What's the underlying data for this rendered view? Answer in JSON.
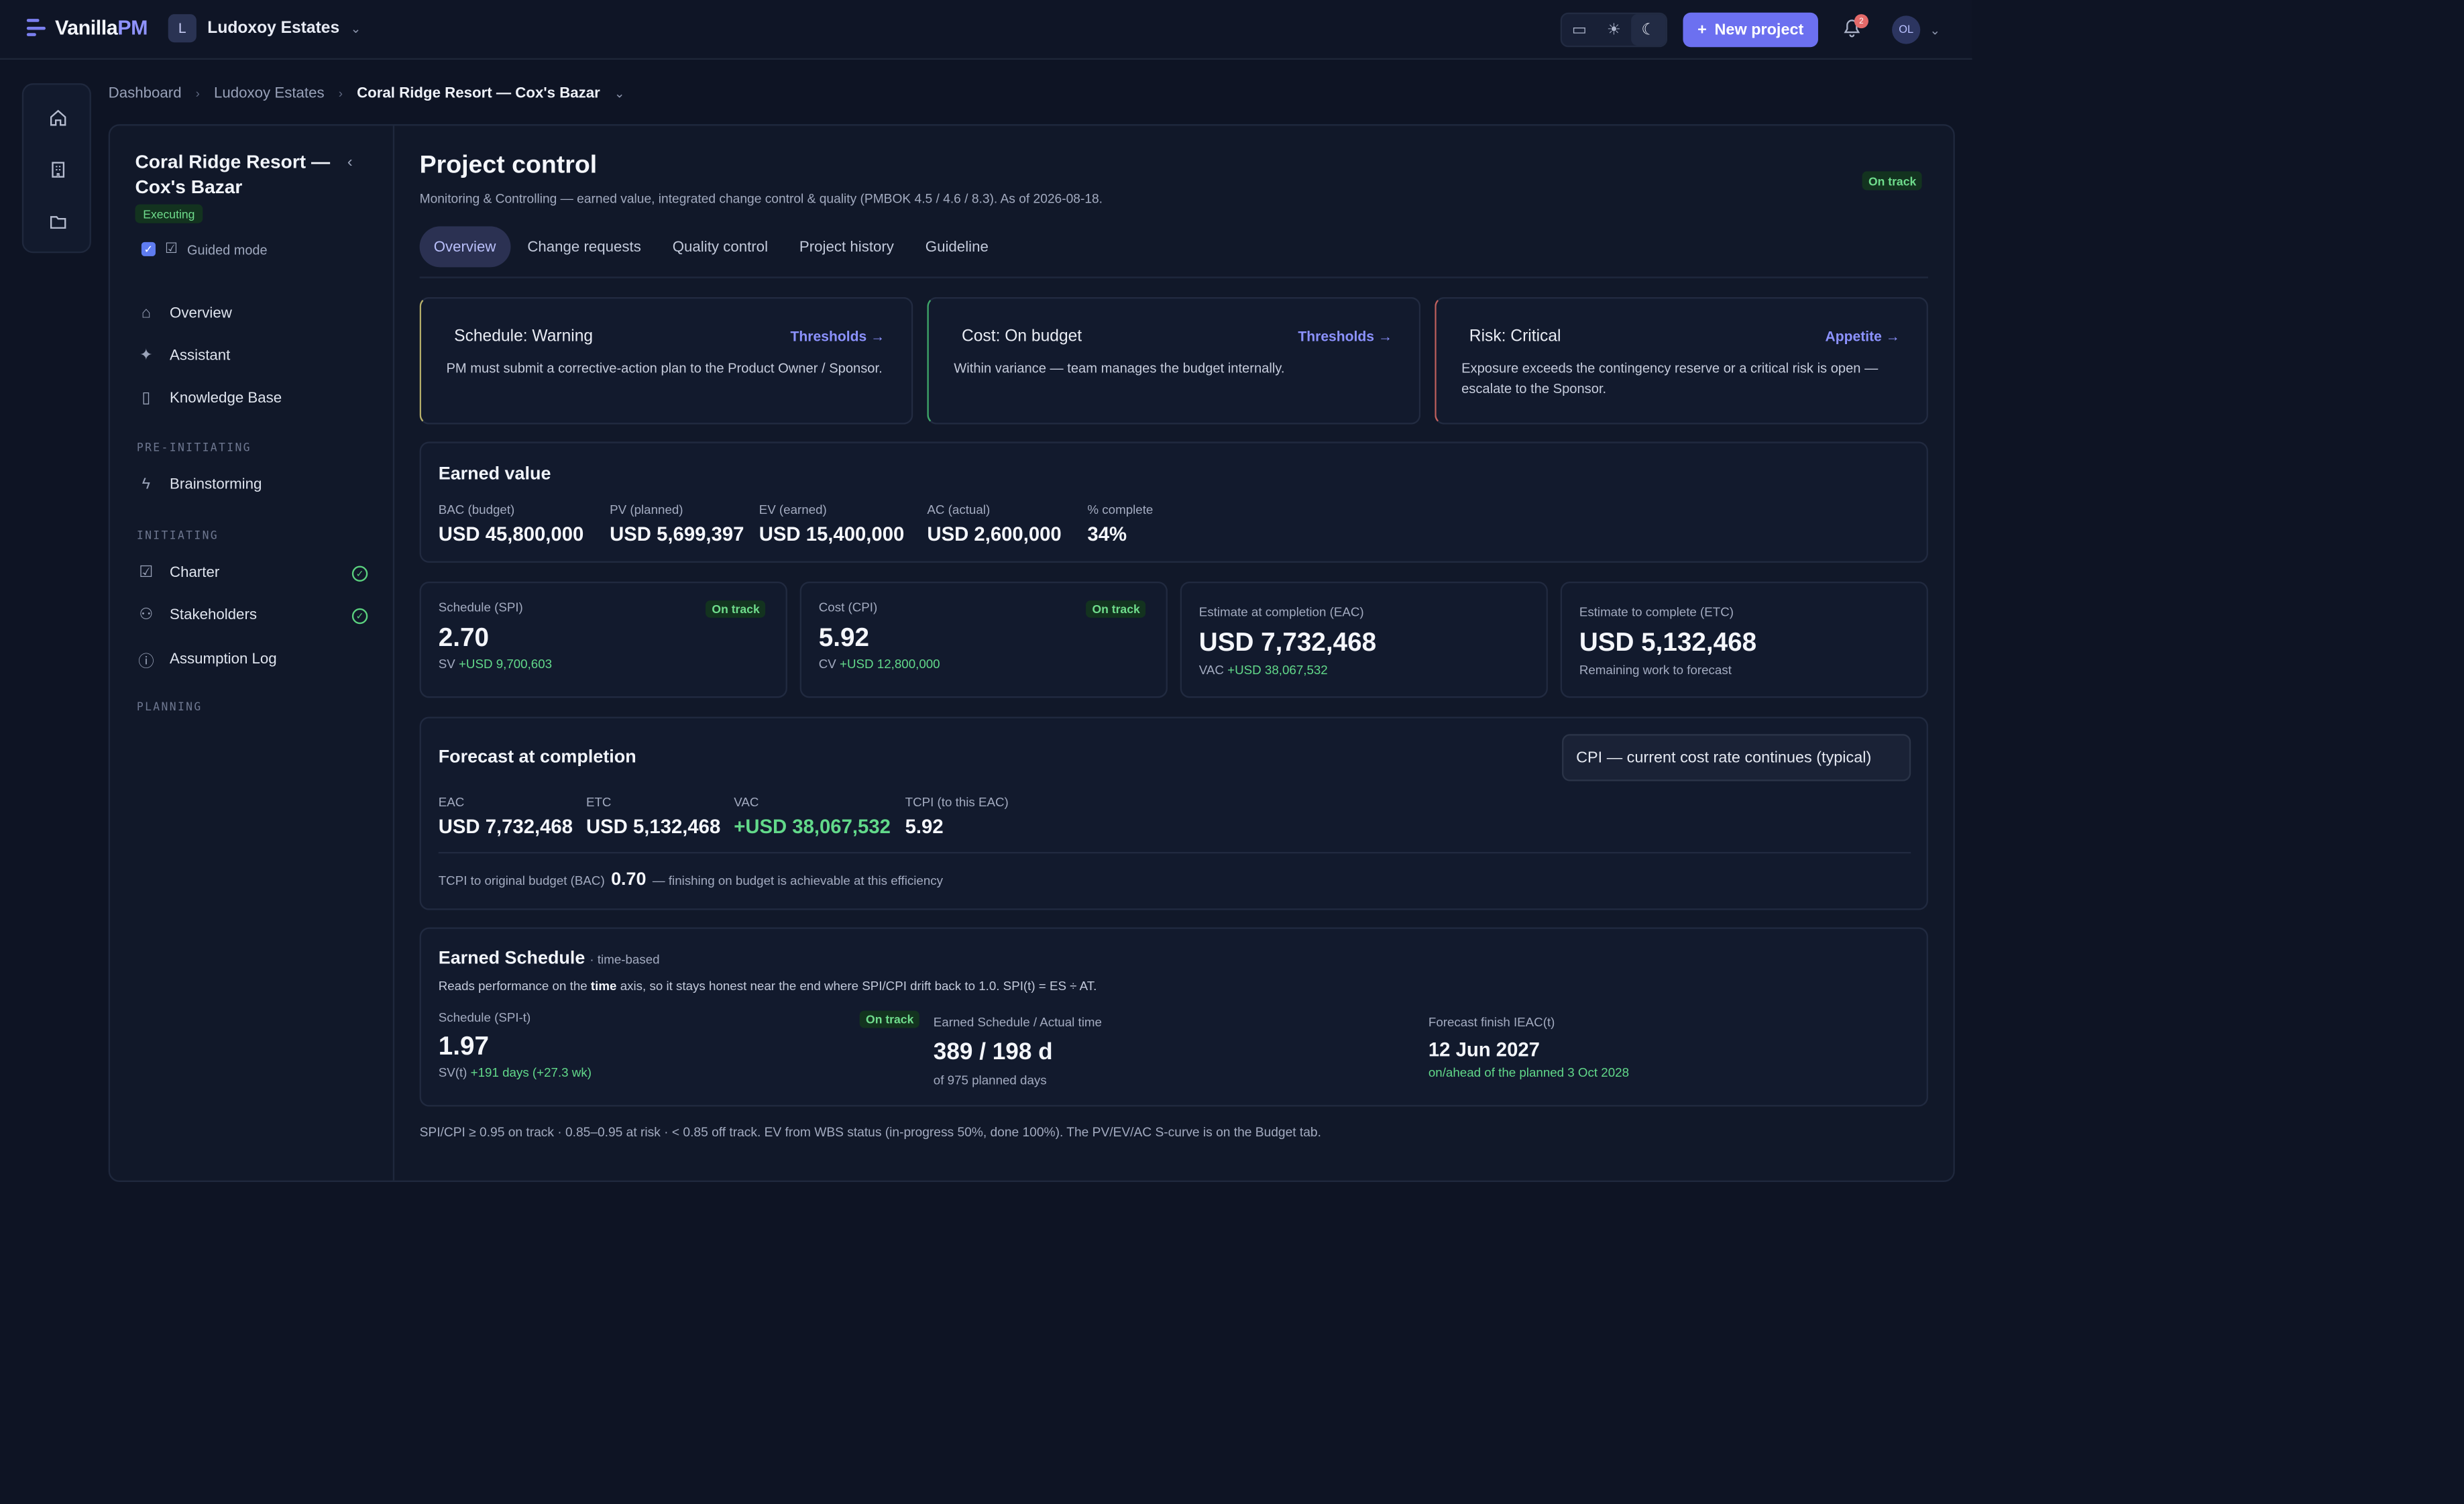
{
  "app": {
    "name_main": "Vanilla",
    "name_accent": "PM"
  },
  "org": {
    "initial": "L",
    "name": "Ludoxoy Estates"
  },
  "header": {
    "new_project_label": "New project",
    "notifications_count": "2",
    "user_initials": "OL"
  },
  "breadcrumb": {
    "items": [
      "Dashboard",
      "Ludoxoy Estates"
    ],
    "current": "Coral Ridge Resort — Cox's Bazar"
  },
  "sidebar": {
    "project_title": "Coral Ridge Resort — Cox's Bazar",
    "phase": "Executing",
    "guided_mode": "Guided mode",
    "items": [
      "Overview",
      "Assistant",
      "Knowledge Base",
      "Brainstorming",
      "Charter",
      "Stakeholders",
      "Assumption Log"
    ],
    "sections": [
      "PRE-INITIATING",
      "INITIATING",
      "PLANNING"
    ]
  },
  "page": {
    "title": "Project control",
    "subtitle": "Monitoring & Controlling — earned value, integrated change control & quality (PMBOK 4.5 / 4.6 / 8.3). As of 2026-08-18.",
    "status": "On track",
    "tabs": [
      "Overview",
      "Change requests",
      "Quality control",
      "Project history",
      "Guideline"
    ]
  },
  "alerts": [
    {
      "title": "Schedule: Warning",
      "link": "Thresholds →",
      "body": "PM must submit a corrective-action plan to the Product Owner / Sponsor."
    },
    {
      "title": "Cost: On budget",
      "link": "Thresholds →",
      "body": "Within variance — team manages the budget internally."
    },
    {
      "title": "Risk: Critical",
      "link": "Appetite →",
      "body": "Exposure exceeds the contingency reserve or a critical risk is open — escalate to the Sponsor."
    }
  ],
  "earned_value": {
    "title": "Earned value",
    "metrics": [
      {
        "label": "BAC (budget)",
        "value": "USD 45,800,000"
      },
      {
        "label": "PV (planned)",
        "value": "USD 5,699,397"
      },
      {
        "label": "EV (earned)",
        "value": "USD 15,400,000"
      },
      {
        "label": "AC (actual)",
        "value": "USD 2,600,000"
      },
      {
        "label": "% complete",
        "value": "34%"
      }
    ]
  },
  "kpis": {
    "spi": {
      "label": "Schedule (SPI)",
      "status": "On track",
      "value": "2.70",
      "sub_label": "SV",
      "sub_value": "+USD 9,700,603"
    },
    "cpi": {
      "label": "Cost (CPI)",
      "status": "On track",
      "value": "5.92",
      "sub_label": "CV",
      "sub_value": "+USD 12,800,000"
    },
    "eac": {
      "label": "Estimate at completion (EAC)",
      "value": "USD 7,732,468",
      "sub_label": "VAC",
      "sub_value": "+USD 38,067,532"
    },
    "etc": {
      "label": "Estimate to complete (ETC)",
      "value": "USD 5,132,468",
      "sub": "Remaining work to forecast"
    }
  },
  "forecast": {
    "title": "Forecast at completion",
    "method": "CPI — current cost rate continues (typical)",
    "metrics": [
      {
        "label": "EAC",
        "value": "USD 7,732,468"
      },
      {
        "label": "ETC",
        "value": "USD 5,132,468"
      },
      {
        "label": "VAC",
        "value": "+USD 38,067,532"
      },
      {
        "label": "TCPI (to this EAC)",
        "value": "5.92"
      }
    ],
    "tcpi_prefix": "TCPI to original budget (BAC)",
    "tcpi_value": "0.70",
    "tcpi_suffix": "— finishing on budget is achievable at this efficiency"
  },
  "earned_schedule": {
    "title": "Earned Schedule",
    "title_note": "· time-based",
    "desc_pre": "Reads performance on the",
    "desc_bold": "time",
    "desc_post": "axis, so it stays honest near the end where SPI/CPI drift back to 1.0. SPI(t) = ES ÷ AT.",
    "spit_label": "Schedule (SPI-t)",
    "spit_status": "On track",
    "spit_value": "1.97",
    "spit_sub_label": "SV(t)",
    "spit_sub_value": "+191 days (+27.3 wk)",
    "es_label": "Earned Schedule / Actual time",
    "es_value": "389 / 198 d",
    "es_sub": "of 975 planned days",
    "finish_label": "Forecast finish IEAC(t)",
    "finish_value": "12 Jun 2027",
    "finish_sub": "on/ahead of the planned 3 Oct 2028"
  },
  "footer_note": "SPI/CPI ≥ 0.95 on track · 0.85–0.95 at risk · < 0.85 off track. EV from WBS status (in-progress 50%, done 100%). The PV/EV/AC S-curve is on the Budget tab."
}
